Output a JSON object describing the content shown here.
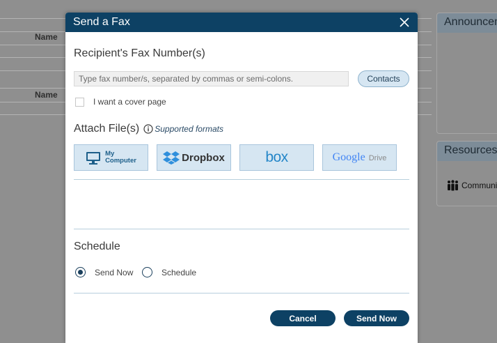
{
  "background": {
    "column_header": "Name",
    "announcements_title": "Announcements",
    "resources_title": "Resources",
    "resource_item": "Community"
  },
  "dialog": {
    "title": "Send a Fax",
    "recipient": {
      "heading": "Recipient's Fax Number(s)",
      "placeholder": "Type fax number/s, separated by commas or semi-colons.",
      "value": "",
      "contacts_label": "Contacts"
    },
    "cover_page": {
      "label": "I want a cover page",
      "checked": false
    },
    "attach": {
      "heading": "Attach File(s)",
      "formats_link": "Supported formats",
      "sources": [
        {
          "id": "my-computer",
          "line1": "My",
          "line2": "Computer"
        },
        {
          "id": "dropbox",
          "label": "Dropbox"
        },
        {
          "id": "box",
          "label": "box"
        },
        {
          "id": "google-drive",
          "label_google": "Google",
          "label_drive": "Drive"
        }
      ]
    },
    "schedule": {
      "heading": "Schedule",
      "options": [
        {
          "label": "Send Now",
          "selected": true
        },
        {
          "label": "Schedule",
          "selected": false
        }
      ]
    },
    "footer": {
      "cancel_label": "Cancel",
      "send_label": "Send Now"
    }
  },
  "colors": {
    "header_bg": "#0d4164",
    "button_bg": "#0d4164",
    "source_bg": "#d6e6f2",
    "overlay": "#8f8f8f",
    "google_blue": "#4285f4",
    "google_red": "#db4437",
    "google_yellow": "#f4b400",
    "google_green": "#0f9d58",
    "box_blue": "#2486c8",
    "dropbox_blue": "#2f8fdc"
  }
}
